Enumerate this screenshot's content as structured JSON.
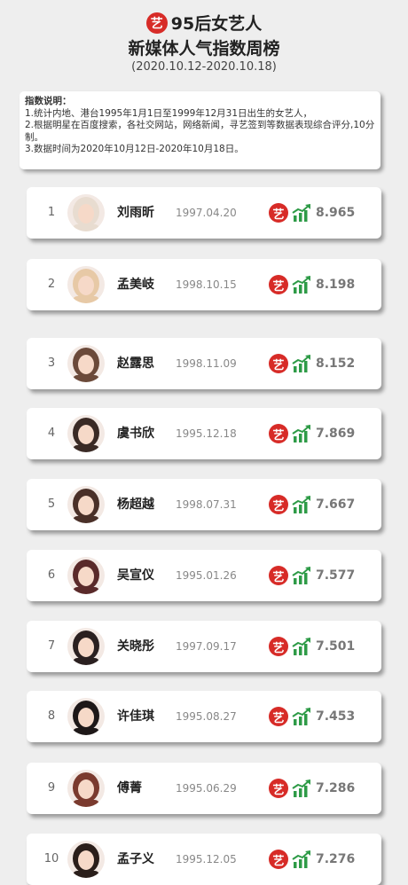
{
  "header": {
    "logo_char": "艺",
    "title_line1": "95后女艺人",
    "title_line2": "新媒体人气指数周榜",
    "date_range": "(2020.10.12-2020.10.18)"
  },
  "notes": {
    "title": "指数说明：",
    "lines": [
      "1.统计内地、港台1995年1月1日至1999年12月31日出生的女艺人，",
      "2.根据明星在百度搜索，各社交网站，网络新闻，寻艺签到等数据表现综合评分,10分制。",
      "3.数据时间为2020年10月12日-2020年10月18日。"
    ]
  },
  "brand_char": "艺",
  "colors": {
    "brand": "#d72b27",
    "trend": "#2e9b47",
    "background": "#eeeeee"
  },
  "rankings": [
    {
      "rank": "1",
      "name": "刘雨昕",
      "birth": "1997.04.20",
      "score": "8.965",
      "avatar_icon": "person-avatar",
      "hair": "#e8dcd0"
    },
    {
      "rank": "2",
      "name": "孟美岐",
      "birth": "1998.10.15",
      "score": "8.198",
      "avatar_icon": "person-avatar",
      "hair": "#e7c9a6"
    },
    {
      "rank": "3",
      "name": "赵露思",
      "birth": "1998.11.09",
      "score": "8.152",
      "avatar_icon": "person-avatar",
      "hair": "#6b4a3a"
    },
    {
      "rank": "4",
      "name": "虞书欣",
      "birth": "1995.12.18",
      "score": "7.869",
      "avatar_icon": "person-avatar",
      "hair": "#3a2a25"
    },
    {
      "rank": "5",
      "name": "杨超越",
      "birth": "1998.07.31",
      "score": "7.667",
      "avatar_icon": "person-avatar",
      "hair": "#4a3028"
    },
    {
      "rank": "6",
      "name": "吴宣仪",
      "birth": "1995.01.26",
      "score": "7.577",
      "avatar_icon": "person-avatar",
      "hair": "#5a2a2a"
    },
    {
      "rank": "7",
      "name": "关晓彤",
      "birth": "1997.09.17",
      "score": "7.501",
      "avatar_icon": "person-avatar",
      "hair": "#2a2020"
    },
    {
      "rank": "8",
      "name": "许佳琪",
      "birth": "1995.08.27",
      "score": "7.453",
      "avatar_icon": "person-avatar",
      "hair": "#1e1818"
    },
    {
      "rank": "9",
      "name": "傅菁",
      "birth": "1995.06.29",
      "score": "7.286",
      "avatar_icon": "person-avatar",
      "hair": "#7a3a2e"
    },
    {
      "rank": "10",
      "name": "孟子义",
      "birth": "1995.12.05",
      "score": "7.276",
      "avatar_icon": "person-avatar",
      "hair": "#2a1e1a"
    }
  ]
}
